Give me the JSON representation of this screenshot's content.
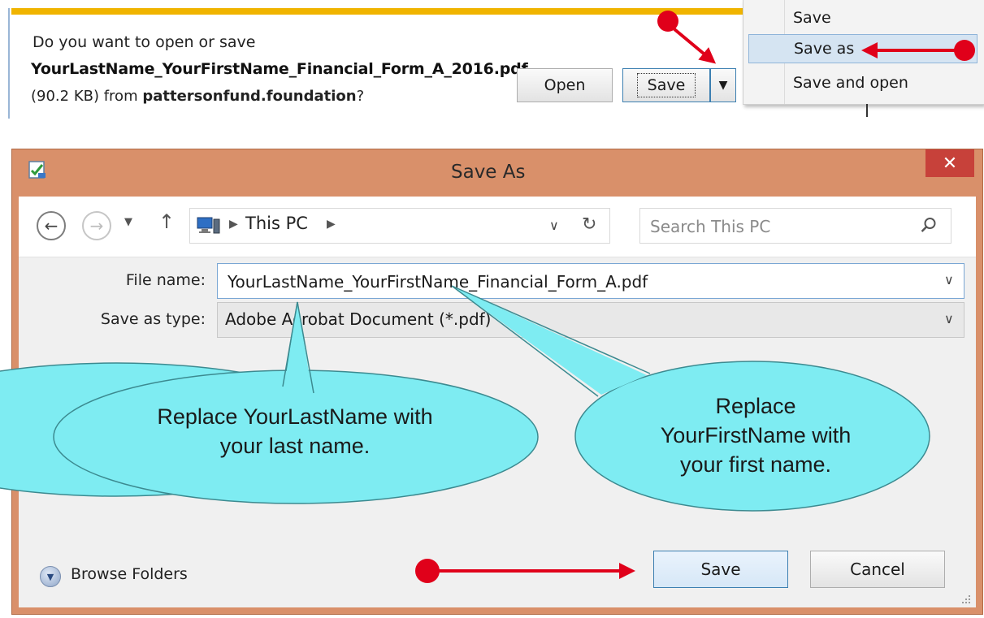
{
  "download_bar": {
    "question": "Do you want to open or save",
    "filename": "YourLastName_YourFirstName_Financial_Form_A_2016.pdf",
    "size": "(90.2 KB) from ",
    "source_domain": "pattersonfund.foundation",
    "source_suffix": "?",
    "open_label": "Open",
    "save_label": "Save",
    "dropdown_glyph": "▼",
    "menu": [
      {
        "label": "Save"
      },
      {
        "label": "Save as"
      },
      {
        "label": "Save and open"
      }
    ]
  },
  "dialog": {
    "title": "Save As",
    "close_glyph": "✕",
    "nav": {
      "back_glyph": "←",
      "forward_glyph": "→",
      "recent_glyph": "▼",
      "up_glyph": "↑",
      "address_sep": "▶",
      "address_location": "This PC",
      "address_chevron": "∨",
      "refresh_glyph": "↻",
      "search_placeholder": "Search This PC"
    },
    "file_name_label": "File name:",
    "file_name_value": "YourLastName_YourFirstName_Financial_Form_A.pdf",
    "file_name_chevron": "∨",
    "save_type_label": "Save as type:",
    "save_type_value": "Adobe Acrobat Document (*.pdf)",
    "save_type_chevron": "∨",
    "browse_glyph": "▼",
    "browse_label": "Browse Folders",
    "save_button": "Save",
    "cancel_button": "Cancel"
  },
  "callouts": {
    "last_name": "Replace YourLastName with\nyour last name.",
    "first_name": "Replace\nYourFirstName with\nyour first name."
  },
  "colors": {
    "dialog_frame": "#d9906a",
    "close_button": "#c7413a",
    "callout_fill": "#7eecf2",
    "annotation_red": "#e0001a",
    "download_bar_accent": "#f0b400",
    "menu_highlight": "#d5e4f2"
  },
  "icons": {
    "app": "save-document-icon",
    "computer": "computer-icon",
    "search": "magnifier-icon",
    "resize": "resize-grip-icon"
  }
}
